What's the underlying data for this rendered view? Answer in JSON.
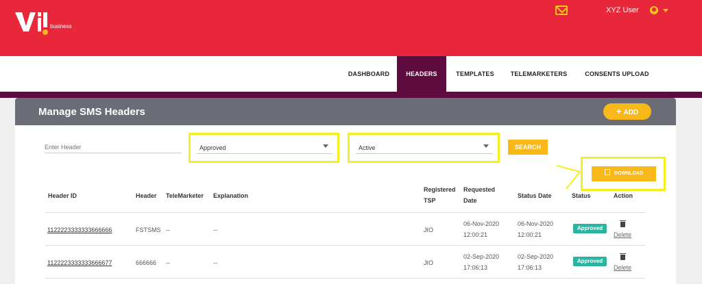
{
  "brand": {
    "logo_text": "business",
    "colors": {
      "primary": "#e8283a",
      "accent": "#f9b81a",
      "nav_active": "#5e0b40",
      "badge": "#2bb4a0"
    }
  },
  "header": {
    "user_name": "XYZ User",
    "mail_icon": "mail-icon",
    "user_icon": "user-icon"
  },
  "nav": {
    "items": [
      {
        "label": "DASHBOARD"
      },
      {
        "label": "HEADERS"
      },
      {
        "label": "TEMPLATES"
      },
      {
        "label": "TELEMARKETERS"
      },
      {
        "label": "CONSENTS UPLOAD"
      }
    ],
    "active": "HEADERS"
  },
  "panel": {
    "title": "Manage SMS Headers",
    "add_label": "ADD"
  },
  "filters": {
    "header_placeholder": "Enter Header",
    "status_value": "Approved",
    "state_value": "Active",
    "search_label": "SEARCH",
    "download_label": "DOWNLOAD"
  },
  "table": {
    "columns": {
      "header_id": "Header ID",
      "header": "Header",
      "telemarketer": "TeleMarketer",
      "explanation": "Explanation",
      "registered_tsp_1": "Registered",
      "registered_tsp_2": "TSP",
      "requested_date_1": "Requested",
      "requested_date_2": "Date",
      "status_date": "Status Date",
      "status": "Status",
      "action": "Action"
    },
    "rows": [
      {
        "header_id": "1122223333333666666",
        "header": "FSTSMS",
        "telemarketer": "--",
        "explanation": "--",
        "tsp": "JIO",
        "requested_date": "06-Nov-2020",
        "requested_time": "12:00:21",
        "status_date": "06-Nov-2020",
        "status_time": "12:00:21",
        "status": "Approved",
        "action": "Delete"
      },
      {
        "header_id": "1122223333333666677",
        "header": "666666",
        "telemarketer": "--",
        "explanation": "--",
        "tsp": "JIO",
        "requested_date": "02-Sep-2020",
        "requested_time": "17:06:13",
        "status_date": "02-Sep-2020",
        "status_time": "17:06:13",
        "status": "Approved",
        "action": "Delete"
      }
    ]
  }
}
